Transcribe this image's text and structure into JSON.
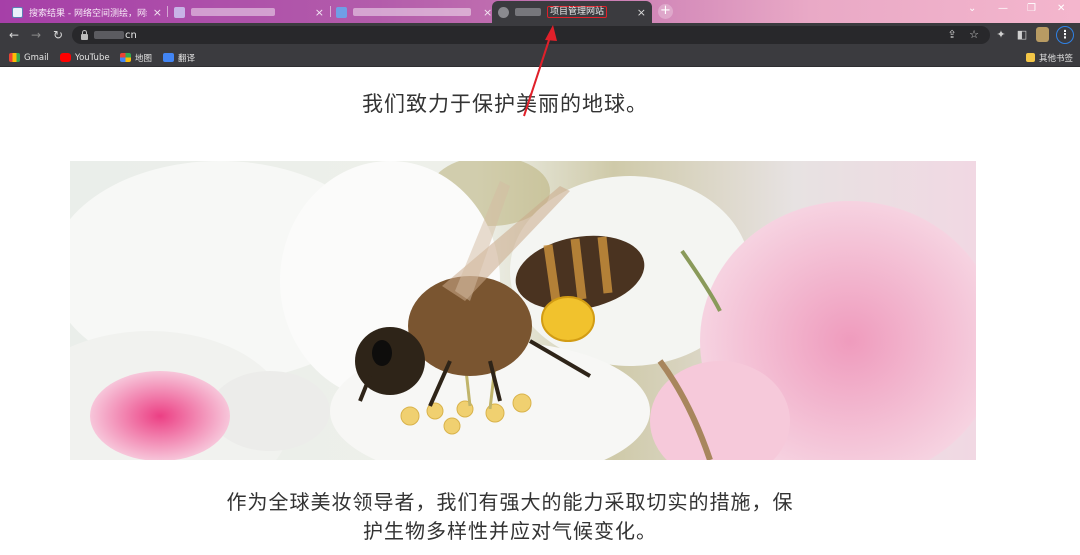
{
  "tabs": [
    {
      "title": "搜索结果 - 网络空间测绘，网络空",
      "close": "×"
    },
    {
      "title": "",
      "close": "×"
    },
    {
      "title": "",
      "close": "×"
    },
    {
      "title": "项目管理网站",
      "close": "×"
    }
  ],
  "new_tab_label": "+",
  "window_controls": {
    "dropdown": "⌄",
    "minimize": "—",
    "restore": "❐",
    "close": "✕"
  },
  "toolbar": {
    "back": "←",
    "forward": "→",
    "reload": "↻",
    "url_suffix": "cn",
    "share": "⇪",
    "star": "☆",
    "extensions": "✦",
    "sidepanel": "◧",
    "menu": "⋮"
  },
  "bookmarks": [
    {
      "label": "Gmail",
      "icon": "gmail-icon"
    },
    {
      "label": "YouTube",
      "icon": "youtube-icon"
    },
    {
      "label": "地图",
      "icon": "maps-icon"
    },
    {
      "label": "翻译",
      "icon": "translate-icon"
    }
  ],
  "other_bookmarks": "其他书签",
  "page": {
    "headline": "我们致力于保护美丽的地球。",
    "hero_image": "bee-on-flower-photo",
    "body_line1": "作为全球美妆领导者，我们有强大的能力采取切实的措施，保",
    "body_line2": "护生物多样性并应对气候变化。"
  },
  "colors": {
    "tabstrip_start": "#a63fa8",
    "tabstrip_end": "#f4b6cd",
    "toolbar": "#3b3b3f",
    "annotation": "#e0202a",
    "text": "#333333"
  }
}
